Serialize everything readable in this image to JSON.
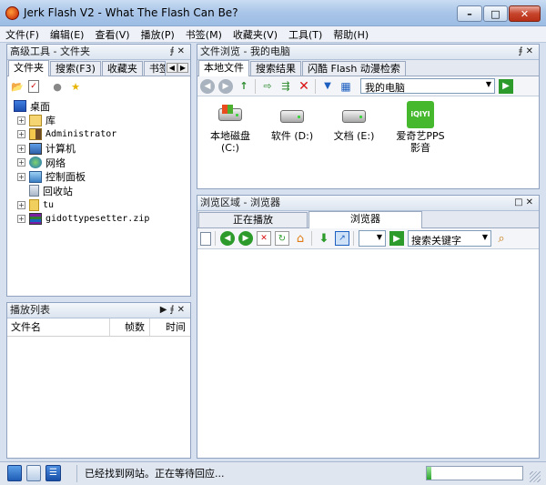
{
  "window": {
    "title": "Jerk Flash V2 - What The Flash Can Be?"
  },
  "menubar": [
    "文件(F)",
    "编辑(E)",
    "查看(V)",
    "播放(P)",
    "书签(M)",
    "收藏夹(V)",
    "工具(T)",
    "帮助(H)"
  ],
  "folder_panel": {
    "title": "高级工具 - 文件夹",
    "tabs": [
      "文件夹",
      "搜索(F3)",
      "收藏夹",
      "书签"
    ],
    "tree": [
      {
        "label": "桌面",
        "icon": "desktop-icon"
      },
      {
        "label": "库",
        "icon": "library-icon"
      },
      {
        "label": "Administrator",
        "icon": "user-folder-icon"
      },
      {
        "label": "计算机",
        "icon": "computer-icon"
      },
      {
        "label": "网络",
        "icon": "network-icon"
      },
      {
        "label": "控制面板",
        "icon": "control-panel-icon"
      },
      {
        "label": "回收站",
        "icon": "recycle-bin-icon"
      },
      {
        "label": "tu",
        "icon": "folder-icon"
      },
      {
        "label": "gidottypesetter.zip",
        "icon": "zip-icon"
      }
    ]
  },
  "playlist_panel": {
    "title": "播放列表",
    "columns": [
      "文件名",
      "帧数",
      "时间"
    ]
  },
  "browser_panel": {
    "title": "文件浏览 - 我的电脑",
    "tabs": [
      "本地文件",
      "搜索结果",
      "闪酷 Flash 动漫检索"
    ],
    "address": "我的电脑",
    "drives": [
      {
        "label": "本地磁盘\n(C:)",
        "icon": "windows-drive-icon"
      },
      {
        "label": "软件 (D:)",
        "icon": "hard-drive-icon"
      },
      {
        "label": "文档 (E:)",
        "icon": "hard-drive-icon"
      },
      {
        "label": "爱奇艺PPS影音",
        "icon": "iqiyi-icon",
        "badge": "iQIYI"
      }
    ]
  },
  "web_panel": {
    "title": "浏览区域 - 浏览器",
    "tabs": [
      "正在播放",
      "浏览器"
    ],
    "search_placeholder": "搜索关键字"
  },
  "statusbar": {
    "text": "已经找到网站。正在等待回应..."
  },
  "colors": {
    "accent": "#1e8a1e",
    "titlebar": "#a9c5e8",
    "close": "#c7452c"
  }
}
